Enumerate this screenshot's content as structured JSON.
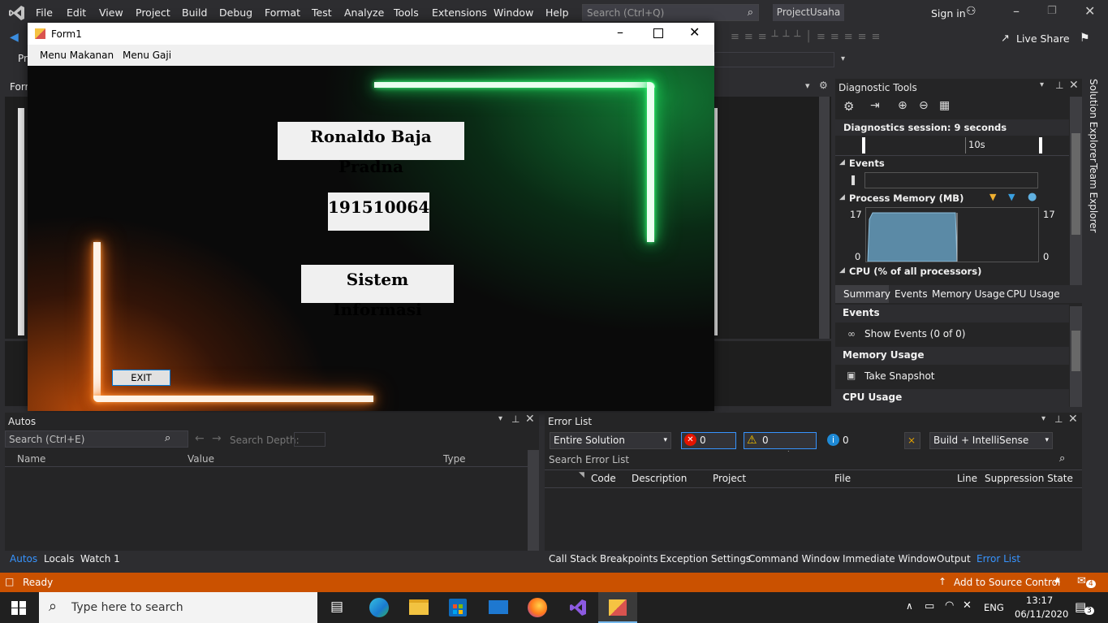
{
  "vs": {
    "menu": [
      "File",
      "Edit",
      "View",
      "Project",
      "Build",
      "Debug",
      "Format",
      "Test",
      "Analyze",
      "Tools",
      "Extensions",
      "Window",
      "Help"
    ],
    "search_placeholder": "Search (Ctrl+Q)",
    "project_name": "ProjectUsaha",
    "sign_in": "Sign in",
    "live_share": "Live Share",
    "left_tab_fragment": "Pr",
    "editor_tab_fragment": "Forr"
  },
  "form1": {
    "title": "Form1",
    "menu": [
      "Menu Makanan",
      "Menu Gaji"
    ],
    "name_label": "Ronaldo Baja Pradna",
    "nim_label": "191510064",
    "major_label": "Sistem Informasi",
    "exit_button": "EXIT"
  },
  "diagnostics": {
    "title": "Diagnostic Tools",
    "session": "Diagnostics session: 9 seconds",
    "timeline_tick": "10s",
    "events_header": "Events",
    "memory_header": "Process Memory (MB)",
    "memory_max_left": "17",
    "memory_min_left": "0",
    "memory_max_right": "17",
    "memory_min_right": "0",
    "cpu_header": "CPU (% of all processors)",
    "tabs": [
      "Summary",
      "Events",
      "Memory Usage",
      "CPU Usage"
    ],
    "sections": {
      "events": "Events",
      "show_events": "Show Events (0 of 0)",
      "memory_usage": "Memory Usage",
      "take_snapshot": "Take Snapshot",
      "cpu_usage": "CPU Usage"
    }
  },
  "autos": {
    "title": "Autos",
    "search_placeholder": "Search (Ctrl+E)",
    "search_depth": "Search Depth:",
    "columns": [
      "Name",
      "Value",
      "Type"
    ],
    "tabs": [
      "Autos",
      "Locals",
      "Watch 1"
    ]
  },
  "errorlist": {
    "title": "Error List",
    "scope": "Entire Solution",
    "errors": "0 Errors",
    "warnings": "0 Warnings",
    "messages": "0 Messages",
    "build_filter": "Build + IntelliSense",
    "search_placeholder": "Search Error List",
    "columns": [
      "Code",
      "Description",
      "Project",
      "File",
      "Line",
      "Suppression State"
    ],
    "bottom_tabs": [
      "Call Stack",
      "Breakpoints",
      "Exception Settings",
      "Command Window",
      "Immediate Window",
      "Output",
      "Error List"
    ]
  },
  "status": {
    "ready": "Ready",
    "source_control": "Add to Source Control",
    "notifications": "4"
  },
  "side_tabs": [
    "Solution Explorer",
    "Team Explorer"
  ],
  "taskbar": {
    "search_placeholder": "Type here to search",
    "language": "ENG",
    "time": "13:17",
    "date": "06/11/2020",
    "notif_count": "3"
  },
  "colors": {
    "status_bar": "#ca5100",
    "accent": "#0078d7",
    "neon_green": "#22e060",
    "neon_orange": "#ff7a1a"
  }
}
